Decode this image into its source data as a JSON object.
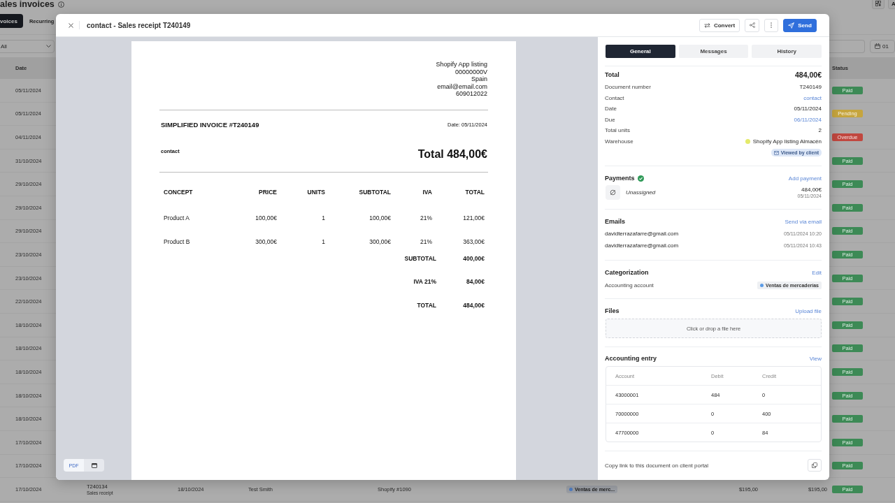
{
  "page": {
    "title": "ales invoices",
    "corner_button": "A",
    "tabs": [
      {
        "label": "voices",
        "selected": true
      },
      {
        "label": "Recurring",
        "selected": false
      }
    ],
    "filter": {
      "value": "All"
    },
    "date_filter": {
      "value": "01"
    },
    "table": {
      "columns": {
        "date": "Date",
        "status": "Status"
      },
      "rows": [
        {
          "date": "05/11/2024",
          "status": {
            "label": "Paid",
            "color": "#3d8a56"
          }
        },
        {
          "date": "05/11/2024",
          "status": {
            "label": "Pending",
            "color": "#c6a53e"
          }
        },
        {
          "date": "04/11/2024",
          "status": {
            "label": "Overdue",
            "color": "#c1473f"
          }
        },
        {
          "date": "31/10/2024",
          "status": {
            "label": "Paid",
            "color": "#3d8a56"
          }
        },
        {
          "date": "29/10/2024",
          "status": {
            "label": "Paid",
            "color": "#3d8a56"
          }
        },
        {
          "date": "29/10/2024",
          "status": {
            "label": "Paid",
            "color": "#3d8a56"
          }
        },
        {
          "date": "29/10/2024",
          "status": {
            "label": "Paid",
            "color": "#3d8a56"
          }
        },
        {
          "date": "23/10/2024",
          "status": {
            "label": "Paid",
            "color": "#3d8a56"
          }
        },
        {
          "date": "23/10/2024",
          "status": {
            "label": "Paid",
            "color": "#3d8a56"
          }
        },
        {
          "date": "22/10/2024",
          "status": {
            "label": "Paid",
            "color": "#3d8a56"
          }
        },
        {
          "date": "18/10/2024",
          "status": {
            "label": "Paid",
            "color": "#3d8a56"
          }
        },
        {
          "date": "18/10/2024",
          "status": {
            "label": "Paid",
            "color": "#3d8a56"
          }
        },
        {
          "date": "18/10/2024",
          "status": {
            "label": "Paid",
            "color": "#3d8a56"
          }
        },
        {
          "date": "18/10/2024",
          "status": {
            "label": "Paid",
            "color": "#3d8a56"
          }
        },
        {
          "date": "18/10/2024",
          "status": {
            "label": "Paid",
            "color": "#3d8a56"
          }
        },
        {
          "date": "17/10/2024",
          "status": {
            "label": "Paid",
            "color": "#3d8a56"
          }
        },
        {
          "date": "17/10/2024",
          "status": {
            "label": "Paid",
            "color": "#3d8a56"
          }
        },
        {
          "date": "17/10/2024",
          "column_2": {
            "title": "T240134",
            "subtitle": "Sales receipt"
          },
          "column_3": "18/10/2024",
          "column_4": "Test Smith",
          "column_5": "Shopify #1090",
          "column_6": "Ventas de merc...",
          "column_7": "$195,00",
          "column_8": "$195,00",
          "status": {
            "label": "Paid",
            "color": "#3d8a56"
          }
        }
      ]
    }
  },
  "modal": {
    "title": "contact - Sales receipt T240149",
    "actions": [
      {
        "kind": "convert",
        "label": "Convert"
      },
      {
        "kind": "share"
      },
      {
        "kind": "more"
      },
      {
        "kind": "send",
        "label": "Send"
      }
    ],
    "preview": {
      "issuer": [
        "Shopify App listing",
        "00000000V",
        "Spain",
        "email@email.com",
        "609012022"
      ],
      "heading": "SIMPLIFIED INVOICE #T240149",
      "date": "Date: 05/11/2024",
      "customer": "contact",
      "total": "Total 484,00€",
      "columns": [
        "CONCEPT",
        "PRICE",
        "UNITS",
        "SUBTOTAL",
        "IVA",
        "TOTAL"
      ],
      "lines": [
        [
          "Product A",
          "100,00€",
          "1",
          "100,00€",
          "21%",
          "121,00€"
        ],
        [
          "Product B",
          "300,00€",
          "1",
          "300,00€",
          "21%",
          "363,00€"
        ]
      ],
      "summary": [
        {
          "label": "SUBTOTAL",
          "value": "400,00€"
        },
        {
          "label": "IVA 21%",
          "value": "84,00€"
        },
        {
          "label": "TOTAL",
          "value": "484,00€"
        }
      ],
      "view_toggle": [
        {
          "label": "PDF",
          "selected": true
        },
        {
          "selected": false
        }
      ]
    },
    "tabs": [
      {
        "label": "General",
        "selected": true
      },
      {
        "label": "Messages",
        "selected": false
      },
      {
        "label": "History",
        "selected": false
      }
    ],
    "summary": {
      "label": "Total",
      "value": "484,00€",
      "fields": [
        {
          "label": "Document number",
          "value": "T240149",
          "kind": "text"
        },
        {
          "label": "Contact",
          "value": "contact",
          "kind": "link"
        },
        {
          "label": "Date",
          "value": "05/11/2024",
          "kind": "text"
        },
        {
          "label": "Due",
          "value": "06/11/2024",
          "kind": "link"
        },
        {
          "label": "Total units",
          "value": "2",
          "kind": "text"
        },
        {
          "label": "Warehouse",
          "value": "Shopify App listing Almacén",
          "kind": "dot"
        }
      ],
      "badge": "Viewed by client"
    },
    "payments": {
      "title": "Payments",
      "paid": true,
      "action": "Add payment",
      "items": [
        {
          "method": "Unassigned",
          "amount": "484,00€",
          "date": "05/11/2024"
        }
      ]
    },
    "emails": {
      "title": "Emails",
      "action": "Send via email",
      "items": [
        {
          "address": "davidterrazafarre@gmail.com",
          "sent": "05/11/2024 10:20"
        },
        {
          "address": "davidterrazafarre@gmail.com",
          "sent": "05/11/2024 10:43"
        }
      ]
    },
    "categorization": {
      "title": "Categorization",
      "action": "Edit",
      "fields": [
        {
          "label": "Accounting account",
          "value": "Ventas de mercaderías"
        }
      ]
    },
    "files": {
      "title": "Files",
      "action": "Upload file",
      "dropzone": "Click or drop a file here"
    },
    "accounting_entry": {
      "title": "Accounting entry",
      "action": "View",
      "columns": [
        "Account",
        "Debit",
        "Credit"
      ],
      "rows": [
        [
          "43000001",
          "484",
          "0"
        ],
        [
          "70000000",
          "0",
          "400"
        ],
        [
          "47700000",
          "0",
          "84"
        ]
      ]
    },
    "portal_link": {
      "label": "Copy link to this document on client portal"
    }
  }
}
